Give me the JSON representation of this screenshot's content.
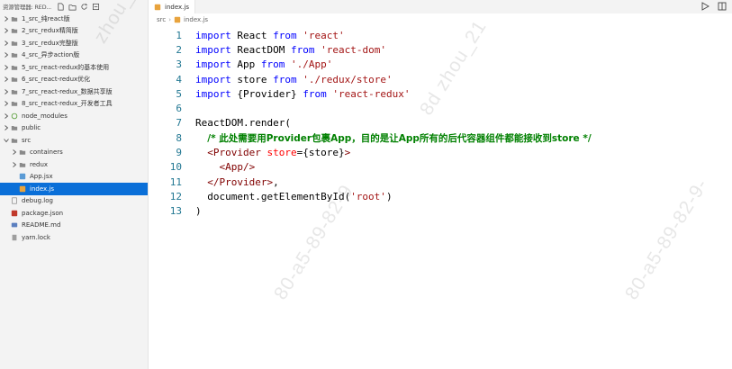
{
  "sidebar": {
    "title": "资源管理器: RED...",
    "actions": [
      "new-file-icon",
      "new-folder-icon",
      "refresh-icon",
      "collapse-icon"
    ],
    "items": [
      {
        "label": "1_src_纯react版",
        "type": "folder",
        "open": false,
        "indent": 0
      },
      {
        "label": "2_src_redux精简版",
        "type": "folder",
        "open": false,
        "indent": 0
      },
      {
        "label": "3_src_redux完整版",
        "type": "folder",
        "open": false,
        "indent": 0
      },
      {
        "label": "4_src_异步action版",
        "type": "folder",
        "open": false,
        "indent": 0
      },
      {
        "label": "5_src_react-redux的基本使用",
        "type": "folder",
        "open": false,
        "indent": 0
      },
      {
        "label": "6_src_react-redux优化",
        "type": "folder",
        "open": false,
        "indent": 0
      },
      {
        "label": "7_src_react-redux_数据共享版",
        "type": "folder",
        "open": false,
        "indent": 0
      },
      {
        "label": "8_src_react-redux_开发者工具",
        "type": "folder",
        "open": false,
        "indent": 0
      },
      {
        "label": "node_modules",
        "type": "node",
        "open": false,
        "indent": 0
      },
      {
        "label": "public",
        "type": "folder",
        "open": false,
        "indent": 0
      },
      {
        "label": "src",
        "type": "folder",
        "open": true,
        "indent": 0
      },
      {
        "label": "containers",
        "type": "folder",
        "open": false,
        "indent": 1
      },
      {
        "label": "redux",
        "type": "folder",
        "open": false,
        "indent": 1
      },
      {
        "label": "App.jsx",
        "type": "jsx",
        "indent": 1
      },
      {
        "label": "index.js",
        "type": "js",
        "indent": 1,
        "selected": true
      },
      {
        "label": "debug.log",
        "type": "log",
        "indent": 0
      },
      {
        "label": "package.json",
        "type": "json",
        "indent": 0
      },
      {
        "label": "README.md",
        "type": "md",
        "indent": 0
      },
      {
        "label": "yarn.lock",
        "type": "lock",
        "indent": 0
      }
    ]
  },
  "editor": {
    "tab_label": "index.js",
    "breadcrumb": [
      "src",
      "index.js"
    ],
    "colors": {
      "keyword": "#0000ff",
      "string": "#a31515",
      "comment": "#008000",
      "tag": "#800000",
      "attribute": "#ff0000",
      "selection": "#0a6fd8"
    },
    "lines": [
      [
        [
          "import",
          "kw"
        ],
        [
          " React ",
          "plain"
        ],
        [
          "from",
          "kw"
        ],
        [
          " ",
          "plain"
        ],
        [
          "'react'",
          "str"
        ]
      ],
      [
        [
          "import",
          "kw"
        ],
        [
          " ReactDOM ",
          "plain"
        ],
        [
          "from",
          "kw"
        ],
        [
          " ",
          "plain"
        ],
        [
          "'react-dom'",
          "str"
        ]
      ],
      [
        [
          "import",
          "kw"
        ],
        [
          " App ",
          "plain"
        ],
        [
          "from",
          "kw"
        ],
        [
          " ",
          "plain"
        ],
        [
          "'./App'",
          "str"
        ]
      ],
      [
        [
          "import",
          "kw"
        ],
        [
          " store ",
          "plain"
        ],
        [
          "from",
          "kw"
        ],
        [
          " ",
          "plain"
        ],
        [
          "'./redux/store'",
          "str"
        ]
      ],
      [
        [
          "import",
          "kw"
        ],
        [
          " {Provider} ",
          "plain"
        ],
        [
          "from",
          "kw"
        ],
        [
          " ",
          "plain"
        ],
        [
          "'react-redux'",
          "str"
        ]
      ],
      [],
      [
        [
          "ReactDOM.render(",
          "plain"
        ]
      ],
      [
        [
          "  ",
          "plain"
        ],
        [
          "/* 此处需要用Provider包裹App，目的是让App所有的后代容器组件都能接收到store */",
          "cmt"
        ]
      ],
      [
        [
          "  ",
          "plain"
        ],
        [
          "<Provider",
          "tag"
        ],
        [
          " ",
          "plain"
        ],
        [
          "store",
          "attr"
        ],
        [
          "={store}",
          "plain"
        ],
        [
          ">",
          "tag"
        ]
      ],
      [
        [
          "    ",
          "plain"
        ],
        [
          "<App/>",
          "tag"
        ]
      ],
      [
        [
          "  ",
          "plain"
        ],
        [
          "</Provider>",
          "tag"
        ],
        [
          ",",
          "plain"
        ]
      ],
      [
        [
          "  document.getElementById(",
          "plain"
        ],
        [
          "'root'",
          "str"
        ],
        [
          ")",
          "plain"
        ]
      ],
      [
        [
          ")",
          "plain"
        ]
      ]
    ]
  },
  "watermark": {
    "text": "80-a5-89-82-9",
    "text2": "8d zhou_21",
    "text3": "80-a5-89-82-9-",
    "text4": "zhou_2"
  }
}
